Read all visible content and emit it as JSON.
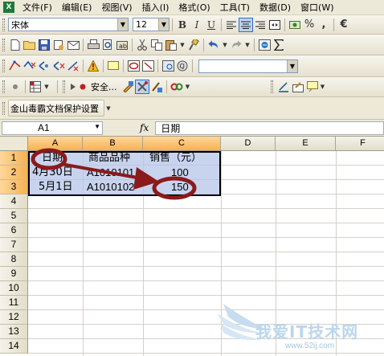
{
  "menubar": {
    "app_icon": "X",
    "items": [
      "文件(F)",
      "编辑(E)",
      "视图(V)",
      "插入(I)",
      "格式(O)",
      "工具(T)",
      "数据(D)",
      "窗口(W)"
    ]
  },
  "format_toolbar": {
    "font_name": "宋体",
    "font_size": "12",
    "bold": "B",
    "italic": "I",
    "underline": "U",
    "percent": "%",
    "comma": ",",
    "currency": "€"
  },
  "security_toolbar": {
    "label": "安全..."
  },
  "jinshan_toolbar": {
    "label": "金山毒霸文档保护设置"
  },
  "formula_bar": {
    "name_box": "A1",
    "fx": "fx",
    "content": "日期"
  },
  "sheet": {
    "columns": [
      "A",
      "B",
      "C",
      "D",
      "E",
      "F"
    ],
    "rows": [
      "1",
      "2",
      "3",
      "4",
      "5",
      "6",
      "7",
      "8",
      "9",
      "10",
      "11",
      "12",
      "13",
      "14"
    ],
    "cells": {
      "A1": "日期",
      "B1": "商品品种",
      "C1": "销售（元）",
      "A2": "4月30日",
      "B2": "A1010101",
      "C2": "100",
      "A3": "5月1日",
      "B3": "A1010102",
      "C3": "150"
    }
  },
  "annotation_color": "#8b1a1a",
  "watermark": {
    "text": "我爱IT技术网",
    "url": "www.52ij.com"
  }
}
